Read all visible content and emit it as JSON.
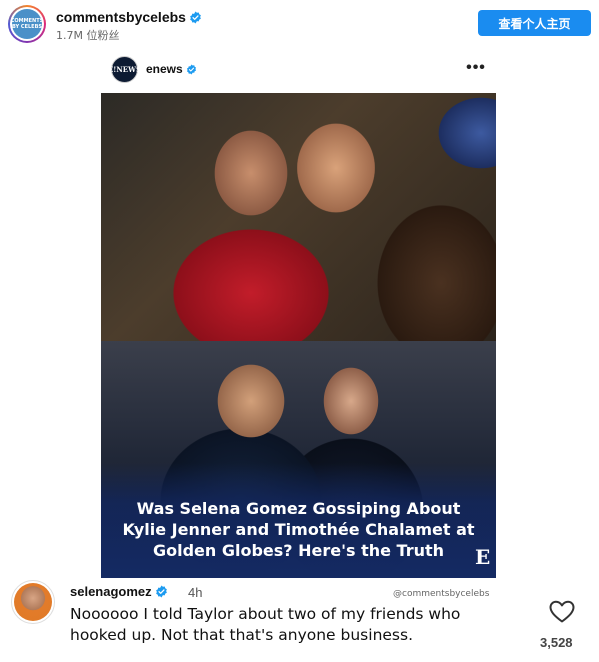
{
  "header": {
    "avatar_text": "COMMENTS BY CELEBS",
    "account_name": "commentsbycelebs",
    "followers": "1.7M 位粉丝",
    "profile_button": "查看个人主页"
  },
  "embed": {
    "avatar_text": "E!NEWS",
    "account_name": "enews",
    "more_label": "•••",
    "headline": "Was Selena Gomez Gossiping About Kylie Jenner and Timothée Chalamet at Golden Globes? Here's the Truth",
    "logo": "E",
    "watermark": "@commentsbycelebs"
  },
  "comment": {
    "username": "selenagomez",
    "time": "4h",
    "text": "Noooooo I told Taylor about two of my friends who hooked up. Not that that's anyone business.",
    "like_count": "3,528"
  },
  "colors": {
    "verified": "#1d9bf0",
    "button": "#1a8cf0",
    "headline_band": "#142a63"
  },
  "icons": {
    "verified": "verified-badge-icon",
    "more": "more-options-icon",
    "like": "heart-icon"
  }
}
